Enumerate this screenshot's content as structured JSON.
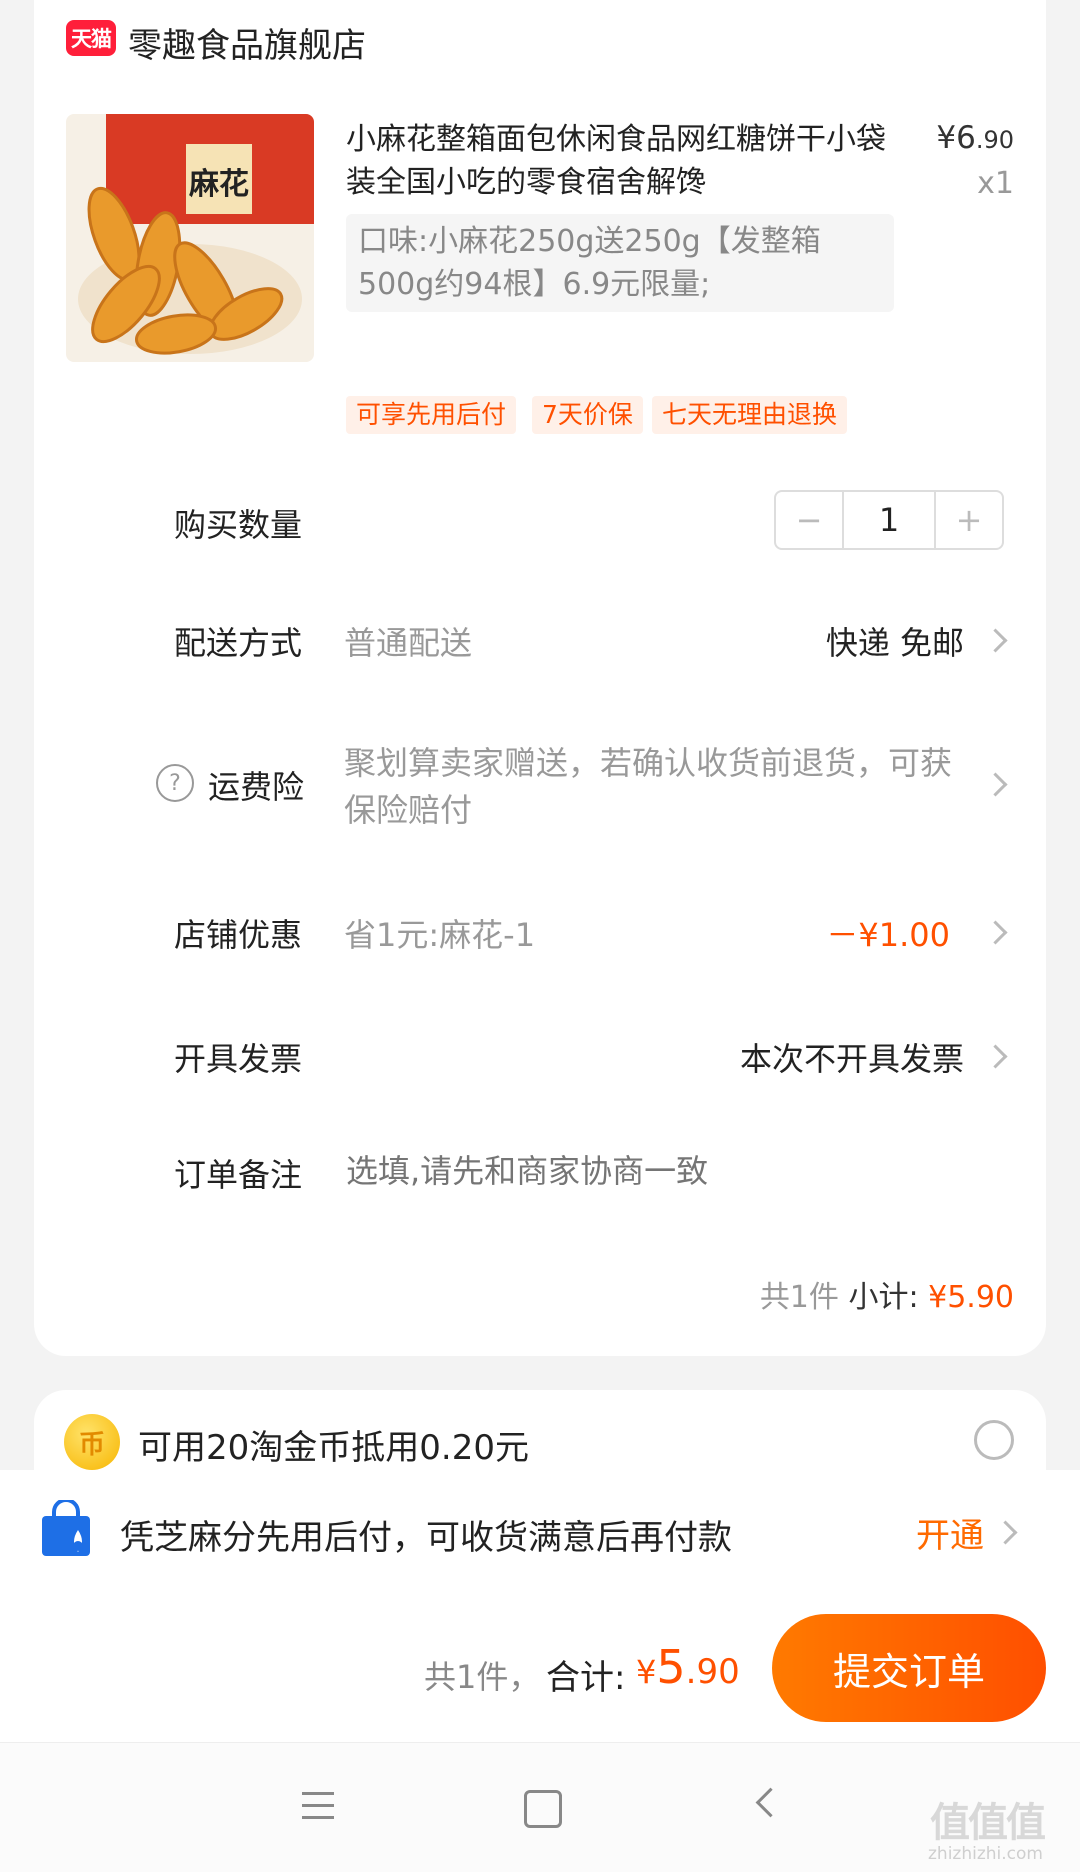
{
  "store": {
    "badge": "天猫",
    "name": "零趣食品旗舰店"
  },
  "product": {
    "title": "小麻花整箱面包休闲食品网红糖饼干小袋装全国小吃的零食宿舍解馋",
    "price_symbol": "¥",
    "price_int": "6",
    "price_dec": ".90",
    "quantity_label": "x1",
    "spec": "口味:小麻花250g送250g【发整箱500g约94根】6.9元限量;",
    "image_label": "麻花",
    "tags": [
      "可享先用后付",
      "7天价保",
      "七天无理由退换"
    ]
  },
  "purchase_qty": {
    "label": "购买数量",
    "minus": "−",
    "value": "1",
    "plus": "+"
  },
  "delivery": {
    "label": "配送方式",
    "value": "普通配送",
    "right": "快递 免邮"
  },
  "insurance": {
    "label": "运费险",
    "help": "?",
    "text": "聚划算卖家赠送，若确认收货前退货，可获保险赔付"
  },
  "shop_discount": {
    "label": "店铺优惠",
    "value": "省1元:麻花-1",
    "amount": "－¥1.00"
  },
  "invoice": {
    "label": "开具发票",
    "right": "本次不开具发票"
  },
  "remark": {
    "label": "订单备注",
    "placeholder": "选填,请先和商家协商一致"
  },
  "subtotal": {
    "count": "共1件",
    "label": "小计:",
    "amount": "¥5.90"
  },
  "coins": {
    "icon_char": "币",
    "text": "可用20淘金币抵用0.20元"
  },
  "zhima": {
    "text": "凭芝麻分先用后付，可收货满意后再付款",
    "action": "开通"
  },
  "checkout": {
    "count": "共1件，",
    "total_label": "合计:",
    "symbol": "¥",
    "total_int": "5",
    "total_dec": ".90",
    "submit": "提交订单"
  },
  "watermark": {
    "text": "值值值",
    "url": "zhizhizhi.com"
  },
  "colors": {
    "accent": "#ff5000",
    "tmall_red": "#ff1f3a"
  }
}
